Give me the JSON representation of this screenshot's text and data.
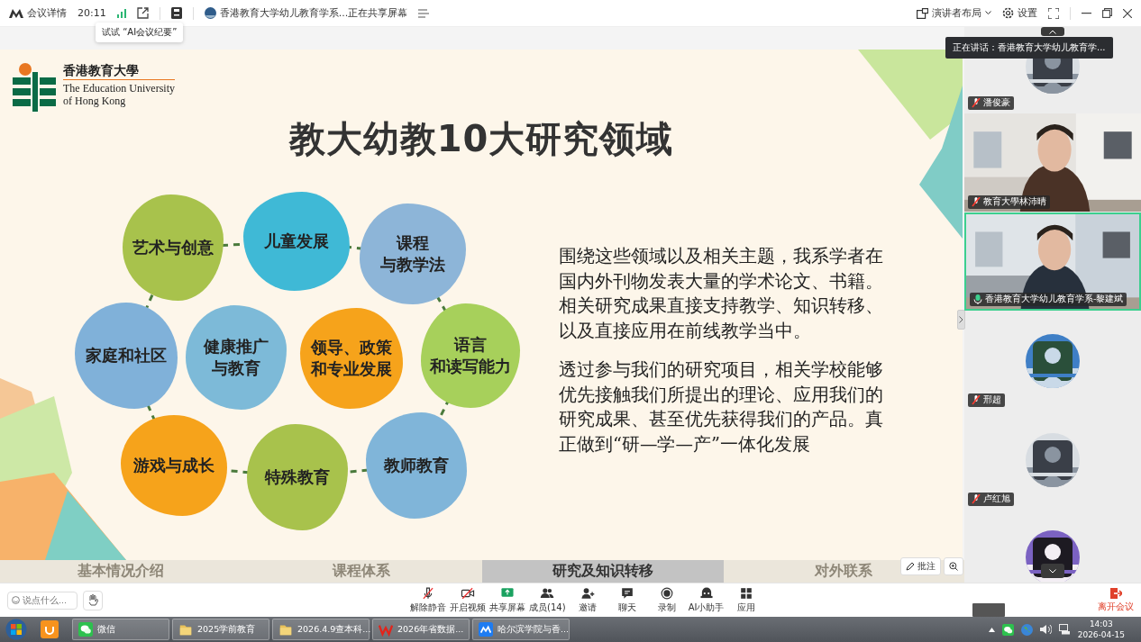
{
  "topbar": {
    "app_label": "会议详情",
    "duration": "20:11",
    "sharing_title": "香港教育大学幼儿教育学系...正在共享屏幕",
    "layout_label": "演讲者布局",
    "settings_label": "设置",
    "tooltip": "试试 “AI会议纪要”"
  },
  "speaking_banner": "正在讲话：香港教育大学幼儿教育学...",
  "slide": {
    "logo_lines": [
      "香港教育大學",
      "The Education University",
      "of Hong Kong"
    ],
    "title": "教大幼教10大研究领域",
    "topics": [
      {
        "lines": [
          "艺术与创意"
        ],
        "color": "#a8c24c"
      },
      {
        "lines": [
          "儿童发展"
        ],
        "color": "#3fb9d6"
      },
      {
        "lines": [
          "课程",
          "与教学法"
        ],
        "color": "#8db5d8"
      },
      {
        "lines": [
          "家庭和社区"
        ],
        "color": "#80b1d9"
      },
      {
        "lines": [
          "健康推广",
          "与教育"
        ],
        "color": "#7dbad8"
      },
      {
        "lines": [
          "领导、政策",
          "和专业发展"
        ],
        "color": "#f6a31b"
      },
      {
        "lines": [
          "语言",
          "和读写能力"
        ],
        "color": "#a7d05b"
      },
      {
        "lines": [
          "游戏与成长"
        ],
        "color": "#f6a31b"
      },
      {
        "lines": [
          "特殊教育"
        ],
        "color": "#a8c24c"
      },
      {
        "lines": [
          "教师教育"
        ],
        "color": "#80b5d9"
      }
    ],
    "paragraphs": [
      "围绕这些领域以及相关主题，我系学者在国内外刊物发表大量的学术论文、书籍。相关研究成果直接支持教学、知识转移、以及直接应用在前线教学当中。",
      "透过参与我们的研究项目，相关学校能够优先接触我们所提出的理论、应用我们的研究成果、甚至优先获得我们的产品。真正做到“研—学—产”一体化发展"
    ],
    "nav_tabs": [
      {
        "label": "基本情况介绍",
        "selected": false
      },
      {
        "label": "课程体系",
        "selected": false
      },
      {
        "label": "研究及知识转移",
        "selected": true
      },
      {
        "label": "对外联系",
        "selected": false
      }
    ]
  },
  "annotate_label": "批注",
  "participants": [
    {
      "name": "潘俊豪",
      "kind": "avatar",
      "muted": true,
      "speaking": false
    },
    {
      "name": "教育大學林沛晴",
      "kind": "video",
      "muted": true,
      "speaking": false
    },
    {
      "name": "香港教育大学幼儿教育学系-黎建斌",
      "kind": "video",
      "muted": false,
      "speaking": true
    },
    {
      "name": "邢超",
      "kind": "avatar",
      "muted": true,
      "speaking": false
    },
    {
      "name": "卢红旭",
      "kind": "avatar",
      "muted": true,
      "speaking": false
    },
    {
      "kind": "avatar",
      "speaking": false
    }
  ],
  "chat_input": {
    "placeholder": "说点什么..."
  },
  "toolbar": [
    "解除静音",
    "开启视频",
    "共享屏幕",
    "成员(14)",
    "邀请",
    "聊天",
    "录制",
    "AI小助手",
    "应用"
  ],
  "leave_label": "离开会议",
  "taskbar": {
    "items": [
      "微信",
      "2025学前教育",
      "2026.4.9查本科...",
      "2026年省数据...",
      "哈尔滨学院与香..."
    ],
    "time": "14:03",
    "date": "2026-04-15"
  }
}
